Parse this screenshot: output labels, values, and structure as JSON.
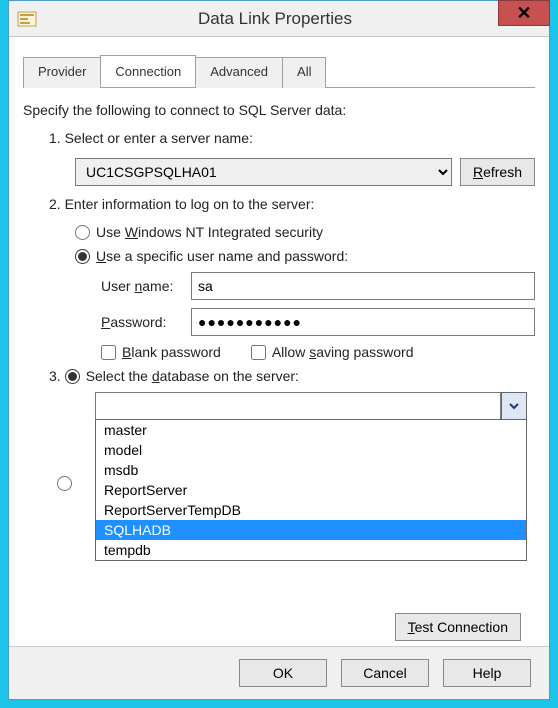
{
  "title": "Data Link Properties",
  "tabs": {
    "provider": "Provider",
    "connection": "Connection",
    "advanced": "Advanced",
    "all": "All"
  },
  "intro": "Specify the following to connect to SQL Server data:",
  "step1": {
    "label": "1. Select or enter a server name:",
    "server": "UC1CSGPSQLHA01",
    "refresh": "Refresh"
  },
  "step2": {
    "label": "2. Enter information to log on to the server:",
    "opt_nt_pre": "Use ",
    "opt_nt_u": "W",
    "opt_nt_post": "indows NT Integrated security",
    "opt_user_u": "U",
    "opt_user_post": "se a specific user name and password:",
    "username_u": "n",
    "username_pre": "User ",
    "username_post": "ame:",
    "username_val": "sa",
    "password_u": "P",
    "password_post": "assword:",
    "password_val": "●●●●●●●●●●●",
    "blank_u": "B",
    "blank_post": "lank password",
    "allow_pre": "Allow ",
    "allow_u": "s",
    "allow_post": "aving password"
  },
  "step3": {
    "num": "3.",
    "sel_pre": "Select the ",
    "sel_u": "d",
    "sel_post": "atabase on the server:",
    "db_value": "",
    "db_options": [
      "master",
      "model",
      "msdb",
      "ReportServer",
      "ReportServerTempDB",
      "SQLHADB",
      "tempdb"
    ],
    "db_selected_index": 5
  },
  "test_u": "T",
  "test_post": "est Connection",
  "buttons": {
    "ok": "OK",
    "cancel": "Cancel",
    "help": "Help"
  }
}
